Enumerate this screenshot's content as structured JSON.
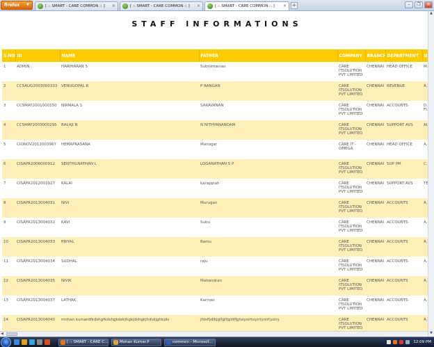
{
  "browser": {
    "menu_label": "firefox",
    "tabs": [
      {
        "label": "[ :: SMART - CARE COMMON :: ]",
        "active": false
      },
      {
        "label": "[ :: SMART - CARE COMMON :: ]",
        "active": false
      },
      {
        "label": "[ :: SMART - CARE COMMON :: ]",
        "active": true
      }
    ],
    "new_tab_label": "+"
  },
  "page": {
    "title": "STAFF INFORMATIONS"
  },
  "table": {
    "columns": [
      "S.NO",
      "ID",
      "NAME",
      "FATHER",
      "COMPANY",
      "BRANCH",
      "DEPARTMENT",
      "D"
    ],
    "rows": [
      [
        "1",
        "ADMIN",
        "HARIHARAN S",
        "Subramanian",
        "CARE ITSOLUTION PVT LIMITED",
        "CHENNAI",
        "HEAD OFFICE",
        "M... D..."
      ],
      [
        "2",
        "CCSAUG2003000333",
        "VENUGOPAL R",
        "P RANGAN",
        "CARE ITSOLUTION PVT LIMITED",
        "CHENNAI",
        "REVENUE",
        "A... M..."
      ],
      [
        "3",
        "CCSMAY2001000150",
        "NIRMALA S",
        "SARAVANAN",
        "CARE ITSOLUTION PVT LIMITED",
        "CHENNAI",
        "ACCOUNTS",
        "D... M... FI..."
      ],
      [
        "4",
        "CCSMAY2003000295",
        "BALAJI N",
        "N NITHYANANDAM",
        "CARE ITSOLUTION PVT LIMITED",
        "CHENNAI",
        "SUPPORT AVS",
        "AI"
      ],
      [
        "5",
        "CIONOV2012003967",
        "HEMAPRASANA",
        "Manogar",
        "CARE IT -OMEGA",
        "CHENNAI",
        "HEAD OFFICE",
        "A... C..."
      ],
      [
        "6",
        "CISAPR2006000912",
        "SENTHILNATHAN L",
        "LOGANATHAN S P",
        "CARE ITSOLUTION PVT LIMITED",
        "CHENNAI",
        "SUP PM",
        "C... S... EI..."
      ],
      [
        "7",
        "CISAPR2012003927",
        "KALAI",
        "karappiah",
        "CARE ITSOLUTION PVT LIMITED",
        "CHENNAI",
        "SUPPORT AVS",
        "TE"
      ],
      [
        "8",
        "CISAPR2013004031",
        "NIVI",
        "Murugan",
        "CARE ITSOLUTION PVT LIMITED",
        "CHENNAI",
        "ACCOUNTS",
        "A... A..."
      ],
      [
        "9",
        "CISAPR2013004032",
        "KAVI",
        "Subu",
        "CARE ITSOLUTION PVT LIMITED",
        "CHENNAI",
        "ACCOUNTS",
        "A... A..."
      ],
      [
        "10",
        "CISAPR2013004033",
        "PRIYAL",
        "Ramu",
        "CARE ITSOLUTION PVT LIMITED",
        "CHENNAI",
        "ACCOUNTS",
        "A... A..."
      ],
      [
        "11",
        "CISAPR2013004034",
        "SUDHAL",
        "raju",
        "CARE ITSOLUTION PVT LIMITED",
        "CHENNAI",
        "ACCOUNTS",
        "A... A..."
      ],
      [
        "12",
        "CISAPR2013004035",
        "NIVIK",
        "Mahendran",
        "CARE ITSOLUTION PVT LIMITED",
        "CHENNAI",
        "ACCOUNTS",
        "A... A..."
      ],
      [
        "13",
        "CISAPR2013004037",
        "LATHAK",
        "Kannan",
        "CARE ITSOLUTION PVT LIMITED",
        "CHENNAI",
        "ACCOUNTS",
        "A... A..."
      ],
      [
        "14",
        "CISAPR2013004040",
        "mohan kumardfkdshgfkdshgkdskjhgkjdshgkjhdskjghkjds",
        "jfdsfljdlkjglfglfjgldflgtoiyoirtoyirtyoirtyoiry",
        "CARE ITSOLUTION PVT LIMITED",
        "CHENNAI",
        "ACCOUNTS",
        "A... A..."
      ]
    ]
  },
  "taskbar": {
    "tasks": [
      {
        "label": "[ :: SMART - CARE C...",
        "icon_color": "#e8761c"
      },
      {
        "label": "Mohan Kumar.P",
        "icon_color": "#d9a441"
      },
      {
        "label": "common - Microsof...",
        "icon_color": "#2e5fb6"
      }
    ],
    "clock": "12:09 PM"
  },
  "colors": {
    "header_bg": "#fccc00",
    "row_alt_bg": "#fcefb7",
    "taskbar_bg": "#1b2438"
  }
}
